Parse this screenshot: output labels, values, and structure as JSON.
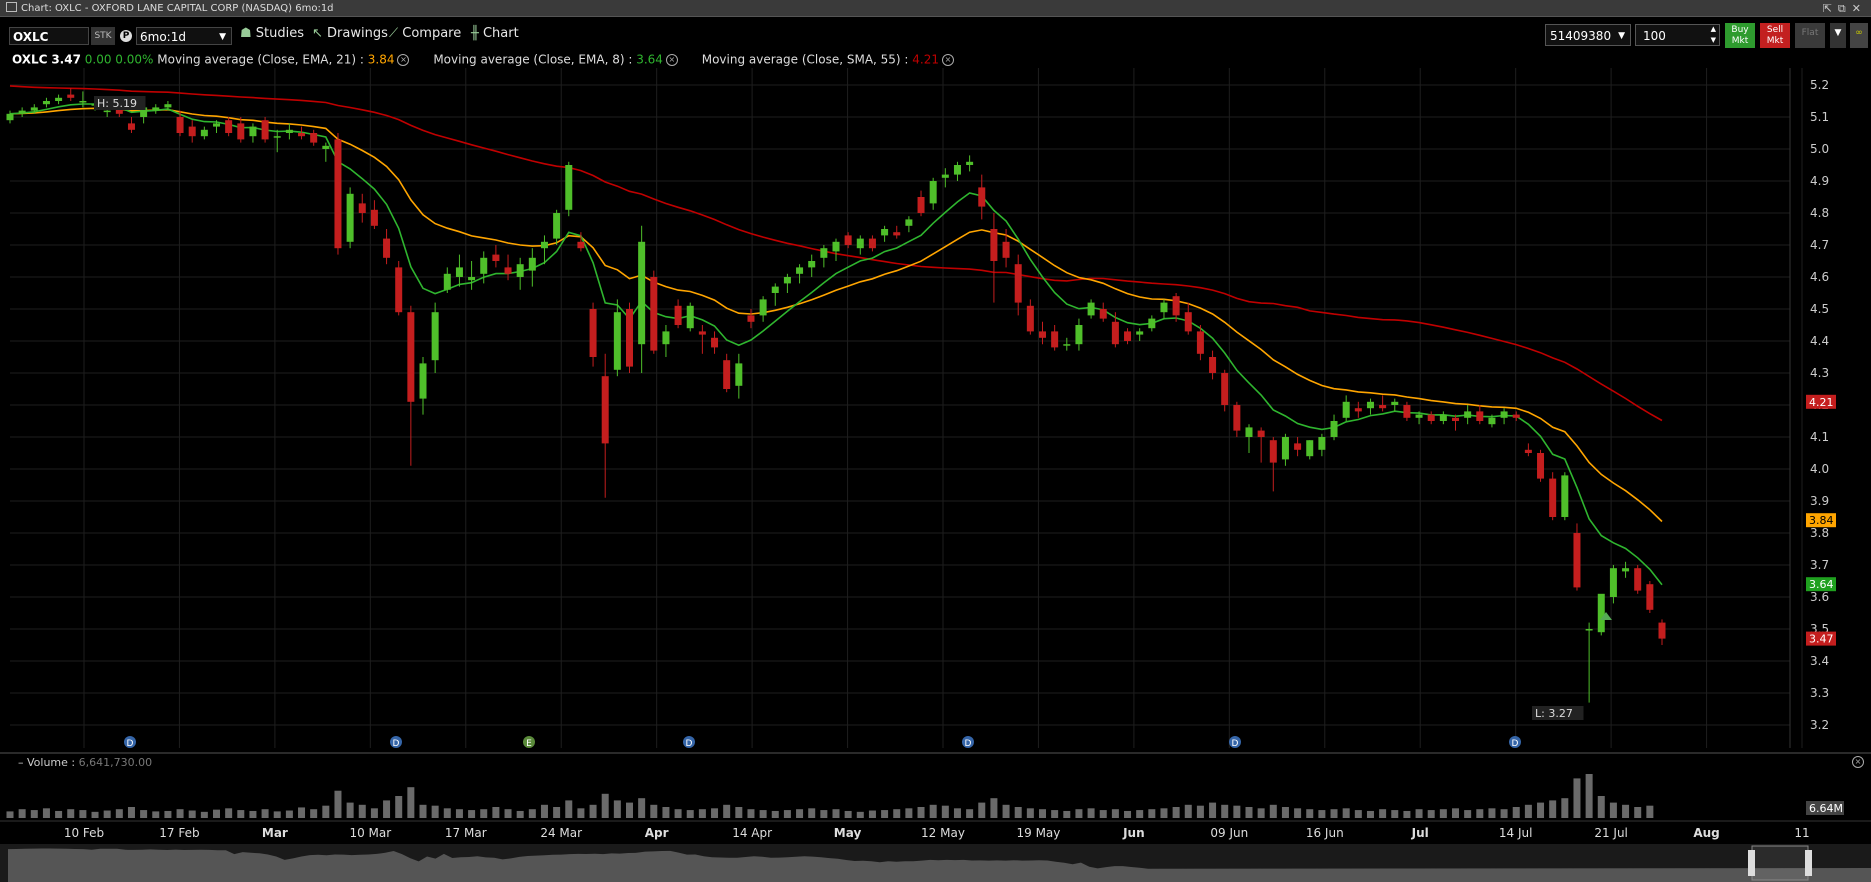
{
  "window": {
    "title": "Chart: OXLC - OXFORD LANE CAPITAL CORP (NASDAQ) 6mo:1d",
    "controls": "⇱⧉✕"
  },
  "toolbar": {
    "symbol": "OXLC",
    "sec_type": "STK",
    "period_icon": "P",
    "period": "6mo:1d",
    "studies": "Studies",
    "drawings": "Drawings",
    "compare": "Compare",
    "chart": "Chart",
    "account": "51409380",
    "quantity": "100",
    "buy_label": "Buy Mkt",
    "sell_label": "Sell Mkt",
    "flat_label": "Flat"
  },
  "legend": {
    "symbol": "OXLC",
    "last": "3.47",
    "change": "0.00",
    "change_pct": "0.00%",
    "studies": [
      {
        "label": "Moving average (Close, EMA, 21) : ",
        "value": "3.84",
        "color": "#ffa500"
      },
      {
        "label": "Moving average (Close, EMA, 8) : ",
        "value": "3.64",
        "color": "#2fb52f"
      },
      {
        "label": "Moving average (Close, SMA, 55) : ",
        "value": "4.21",
        "color": "#c00000"
      }
    ]
  },
  "chart_data": {
    "type": "candlestick",
    "high_marker": "H: 5.19",
    "low_marker": "L: 3.27",
    "y_ticks": [
      "5.2",
      "5.1",
      "5.0",
      "4.9",
      "4.8",
      "4.7",
      "4.6",
      "4.5",
      "4.4",
      "4.3",
      "4.2",
      "4.1",
      "4.0",
      "3.9",
      "3.8",
      "3.7",
      "3.6",
      "3.5",
      "3.4",
      "3.3",
      "3.2"
    ],
    "price_tags": [
      {
        "value": "4.21",
        "color": "#c41e1e"
      },
      {
        "value": "3.84",
        "color": "#ffa500"
      },
      {
        "value": "3.64",
        "color": "#1fa01f"
      },
      {
        "value": "3.47",
        "color": "#c41e1e"
      }
    ],
    "x_labels": [
      {
        "label": "10 Feb",
        "bold": false
      },
      {
        "label": "17 Feb",
        "bold": false
      },
      {
        "label": "Mar",
        "bold": true
      },
      {
        "label": "10 Mar",
        "bold": false
      },
      {
        "label": "17 Mar",
        "bold": false
      },
      {
        "label": "24 Mar",
        "bold": false
      },
      {
        "label": "Apr",
        "bold": true
      },
      {
        "label": "14 Apr",
        "bold": false
      },
      {
        "label": "May",
        "bold": true
      },
      {
        "label": "12 May",
        "bold": false
      },
      {
        "label": "19 May",
        "bold": false
      },
      {
        "label": "Jun",
        "bold": true
      },
      {
        "label": "09 Jun",
        "bold": false
      },
      {
        "label": "16 Jun",
        "bold": false
      },
      {
        "label": "Jul",
        "bold": true
      },
      {
        "label": "14 Jul",
        "bold": false
      },
      {
        "label": "21 Jul",
        "bold": false
      },
      {
        "label": "Aug",
        "bold": true
      },
      {
        "label": "11",
        "bold": false
      }
    ],
    "event_markers": [
      "D",
      "D",
      "E",
      "D",
      "D",
      "D",
      "D"
    ],
    "candles": [
      [
        5.09,
        5.12,
        5.08,
        5.11
      ],
      [
        5.11,
        5.13,
        5.1,
        5.12
      ],
      [
        5.12,
        5.14,
        5.11,
        5.13
      ],
      [
        5.14,
        5.16,
        5.13,
        5.15
      ],
      [
        5.15,
        5.17,
        5.14,
        5.16
      ],
      [
        5.17,
        5.19,
        5.15,
        5.16
      ],
      [
        5.15,
        5.18,
        5.13,
        5.15
      ],
      [
        5.14,
        5.16,
        5.12,
        5.14
      ],
      [
        5.12,
        5.14,
        5.1,
        5.12
      ],
      [
        5.13,
        5.14,
        5.1,
        5.11
      ],
      [
        5.08,
        5.1,
        5.05,
        5.06
      ],
      [
        5.1,
        5.14,
        5.08,
        5.13
      ],
      [
        5.12,
        5.14,
        5.11,
        5.13
      ],
      [
        5.13,
        5.15,
        5.12,
        5.14
      ],
      [
        5.1,
        5.12,
        5.04,
        5.05
      ],
      [
        5.07,
        5.09,
        5.02,
        5.04
      ],
      [
        5.04,
        5.07,
        5.03,
        5.06
      ],
      [
        5.07,
        5.09,
        5.05,
        5.08
      ],
      [
        5.09,
        5.1,
        5.04,
        5.05
      ],
      [
        5.08,
        5.1,
        5.02,
        5.03
      ],
      [
        5.04,
        5.08,
        5.02,
        5.07
      ],
      [
        5.09,
        5.1,
        5.02,
        5.03
      ],
      [
        5.04,
        5.06,
        4.99,
        5.04
      ],
      [
        5.05,
        5.08,
        5.03,
        5.06
      ],
      [
        5.05,
        5.07,
        5.03,
        5.04
      ],
      [
        5.05,
        5.06,
        5.01,
        5.02
      ],
      [
        5.0,
        5.02,
        4.96,
        5.01
      ],
      [
        5.03,
        5.05,
        4.67,
        4.69
      ],
      [
        4.71,
        4.88,
        4.69,
        4.86
      ],
      [
        4.83,
        4.86,
        4.77,
        4.8
      ],
      [
        4.81,
        4.84,
        4.75,
        4.76
      ],
      [
        4.72,
        4.75,
        4.64,
        4.66
      ],
      [
        4.63,
        4.65,
        4.48,
        4.49
      ],
      [
        4.49,
        4.51,
        4.01,
        4.21
      ],
      [
        4.22,
        4.35,
        4.17,
        4.33
      ],
      [
        4.34,
        4.52,
        4.3,
        4.49
      ],
      [
        4.56,
        4.63,
        4.55,
        4.61
      ],
      [
        4.6,
        4.67,
        4.57,
        4.63
      ],
      [
        4.59,
        4.65,
        4.56,
        4.6
      ],
      [
        4.61,
        4.68,
        4.58,
        4.66
      ],
      [
        4.67,
        4.7,
        4.63,
        4.65
      ],
      [
        4.63,
        4.67,
        4.59,
        4.61
      ],
      [
        4.6,
        4.66,
        4.56,
        4.64
      ],
      [
        4.62,
        4.69,
        4.57,
        4.66
      ],
      [
        4.69,
        4.73,
        4.64,
        4.71
      ],
      [
        4.72,
        4.81,
        4.7,
        4.8
      ],
      [
        4.81,
        4.96,
        4.79,
        4.95
      ],
      [
        4.71,
        4.74,
        4.68,
        4.69
      ],
      [
        4.5,
        4.52,
        4.32,
        4.35
      ],
      [
        4.29,
        4.36,
        3.91,
        4.08
      ],
      [
        4.31,
        4.53,
        4.29,
        4.49
      ],
      [
        4.5,
        4.52,
        4.3,
        4.32
      ],
      [
        4.39,
        4.76,
        4.3,
        4.71
      ],
      [
        4.6,
        4.62,
        4.36,
        4.37
      ],
      [
        4.39,
        4.45,
        4.35,
        4.43
      ],
      [
        4.51,
        4.53,
        4.44,
        4.45
      ],
      [
        4.44,
        4.52,
        4.43,
        4.51
      ],
      [
        4.43,
        4.45,
        4.36,
        4.42
      ],
      [
        4.41,
        4.43,
        4.36,
        4.38
      ],
      [
        4.34,
        4.36,
        4.24,
        4.25
      ],
      [
        4.26,
        4.36,
        4.22,
        4.33
      ],
      [
        4.48,
        4.5,
        4.44,
        4.46
      ],
      [
        4.48,
        4.54,
        4.46,
        4.53
      ],
      [
        4.55,
        4.58,
        4.51,
        4.57
      ],
      [
        4.58,
        4.61,
        4.55,
        4.6
      ],
      [
        4.61,
        4.64,
        4.58,
        4.63
      ],
      [
        4.63,
        4.67,
        4.6,
        4.65
      ],
      [
        4.66,
        4.7,
        4.63,
        4.69
      ],
      [
        4.68,
        4.72,
        4.65,
        4.71
      ],
      [
        4.73,
        4.74,
        4.69,
        4.7
      ],
      [
        4.69,
        4.73,
        4.67,
        4.72
      ],
      [
        4.72,
        4.73,
        4.68,
        4.69
      ],
      [
        4.73,
        4.76,
        4.71,
        4.75
      ],
      [
        4.74,
        4.76,
        4.72,
        4.73
      ],
      [
        4.76,
        4.79,
        4.74,
        4.78
      ],
      [
        4.85,
        4.87,
        4.79,
        4.8
      ],
      [
        4.83,
        4.91,
        4.81,
        4.9
      ],
      [
        4.91,
        4.94,
        4.88,
        4.92
      ],
      [
        4.92,
        4.96,
        4.9,
        4.95
      ],
      [
        4.95,
        4.98,
        4.93,
        4.96
      ],
      [
        4.88,
        4.92,
        4.78,
        4.82
      ],
      [
        4.75,
        4.8,
        4.52,
        4.65
      ],
      [
        4.71,
        4.75,
        4.63,
        4.66
      ],
      [
        4.64,
        4.67,
        4.48,
        4.52
      ],
      [
        4.51,
        4.53,
        4.42,
        4.43
      ],
      [
        4.43,
        4.46,
        4.39,
        4.41
      ],
      [
        4.43,
        4.45,
        4.37,
        4.38
      ],
      [
        4.39,
        4.41,
        4.37,
        4.39
      ],
      [
        4.39,
        4.47,
        4.37,
        4.45
      ],
      [
        4.48,
        4.53,
        4.47,
        4.52
      ],
      [
        4.5,
        4.52,
        4.46,
        4.47
      ],
      [
        4.46,
        4.49,
        4.38,
        4.39
      ],
      [
        4.43,
        4.44,
        4.39,
        4.4
      ],
      [
        4.42,
        4.44,
        4.4,
        4.43
      ],
      [
        4.44,
        4.48,
        4.43,
        4.47
      ],
      [
        4.49,
        4.53,
        4.47,
        4.52
      ],
      [
        4.54,
        4.55,
        4.46,
        4.48
      ],
      [
        4.49,
        4.52,
        4.42,
        4.43
      ],
      [
        4.43,
        4.45,
        4.34,
        4.36
      ],
      [
        4.35,
        4.37,
        4.28,
        4.3
      ],
      [
        4.3,
        4.31,
        4.18,
        4.2
      ],
      [
        4.2,
        4.21,
        4.1,
        4.12
      ],
      [
        4.1,
        4.14,
        4.05,
        4.13
      ],
      [
        4.12,
        4.13,
        4.02,
        4.1
      ],
      [
        4.09,
        4.1,
        3.93,
        4.02
      ],
      [
        4.03,
        4.11,
        4.01,
        4.1
      ],
      [
        4.08,
        4.1,
        4.04,
        4.06
      ],
      [
        4.04,
        4.09,
        4.03,
        4.09
      ],
      [
        4.06,
        4.11,
        4.04,
        4.1
      ],
      [
        4.1,
        4.17,
        4.09,
        4.15
      ],
      [
        4.16,
        4.23,
        4.15,
        4.21
      ],
      [
        4.19,
        4.21,
        4.16,
        4.18
      ],
      [
        4.19,
        4.22,
        4.17,
        4.21
      ],
      [
        4.2,
        4.23,
        4.18,
        4.19
      ],
      [
        4.2,
        4.22,
        4.18,
        4.21
      ],
      [
        4.2,
        4.21,
        4.15,
        4.16
      ],
      [
        4.16,
        4.18,
        4.14,
        4.17
      ],
      [
        4.17,
        4.18,
        4.14,
        4.15
      ],
      [
        4.15,
        4.18,
        4.14,
        4.17
      ],
      [
        4.16,
        4.17,
        4.12,
        4.15
      ],
      [
        4.16,
        4.2,
        4.14,
        4.18
      ],
      [
        4.18,
        4.2,
        4.14,
        4.15
      ],
      [
        4.14,
        4.17,
        4.13,
        4.16
      ],
      [
        4.16,
        4.19,
        4.14,
        4.18
      ],
      [
        4.17,
        4.18,
        4.15,
        4.16
      ],
      [
        4.06,
        4.08,
        4.04,
        4.05
      ],
      [
        4.05,
        4.06,
        3.96,
        3.97
      ],
      [
        3.97,
        3.99,
        3.84,
        3.85
      ],
      [
        3.85,
        3.99,
        3.84,
        3.98
      ],
      [
        3.8,
        3.83,
        3.62,
        3.63
      ],
      [
        3.5,
        3.52,
        3.27,
        3.5
      ],
      [
        3.49,
        3.6,
        3.48,
        3.61
      ],
      [
        3.6,
        3.7,
        3.58,
        3.69
      ],
      [
        3.68,
        3.71,
        3.66,
        3.69
      ],
      [
        3.69,
        3.7,
        3.61,
        3.62
      ],
      [
        3.64,
        3.65,
        3.55,
        3.56
      ],
      [
        3.52,
        3.53,
        3.45,
        3.47
      ]
    ],
    "volume": {
      "label": "Volume",
      "value": "6,641,730.00",
      "last_tag": "6.64M",
      "heights": [
        0.15,
        0.2,
        0.18,
        0.22,
        0.16,
        0.2,
        0.18,
        0.14,
        0.17,
        0.2,
        0.25,
        0.18,
        0.15,
        0.16,
        0.2,
        0.17,
        0.14,
        0.19,
        0.22,
        0.18,
        0.16,
        0.2,
        0.15,
        0.17,
        0.24,
        0.2,
        0.28,
        0.62,
        0.35,
        0.3,
        0.22,
        0.4,
        0.5,
        0.7,
        0.3,
        0.28,
        0.22,
        0.2,
        0.18,
        0.2,
        0.25,
        0.2,
        0.16,
        0.2,
        0.3,
        0.25,
        0.4,
        0.22,
        0.3,
        0.55,
        0.4,
        0.35,
        0.45,
        0.3,
        0.25,
        0.2,
        0.18,
        0.2,
        0.22,
        0.3,
        0.25,
        0.2,
        0.18,
        0.16,
        0.18,
        0.2,
        0.22,
        0.18,
        0.2,
        0.16,
        0.14,
        0.17,
        0.18,
        0.2,
        0.22,
        0.25,
        0.3,
        0.28,
        0.22,
        0.2,
        0.35,
        0.45,
        0.3,
        0.25,
        0.22,
        0.2,
        0.18,
        0.16,
        0.2,
        0.22,
        0.18,
        0.2,
        0.16,
        0.18,
        0.2,
        0.22,
        0.25,
        0.3,
        0.28,
        0.35,
        0.3,
        0.28,
        0.25,
        0.22,
        0.3,
        0.25,
        0.22,
        0.2,
        0.18,
        0.2,
        0.22,
        0.18,
        0.16,
        0.2,
        0.18,
        0.16,
        0.2,
        0.18,
        0.2,
        0.22,
        0.18,
        0.2,
        0.22,
        0.2,
        0.25,
        0.3,
        0.35,
        0.4,
        0.45,
        0.9,
        1.0,
        0.5,
        0.35,
        0.3,
        0.25,
        0.28
      ]
    }
  },
  "colors": {
    "up": "#4fbf2a",
    "down": "#c41e1e",
    "ema8": "#2fb52f",
    "ema21": "#ffa500",
    "sma55": "#c00000",
    "grid": "#1e1e1e"
  }
}
